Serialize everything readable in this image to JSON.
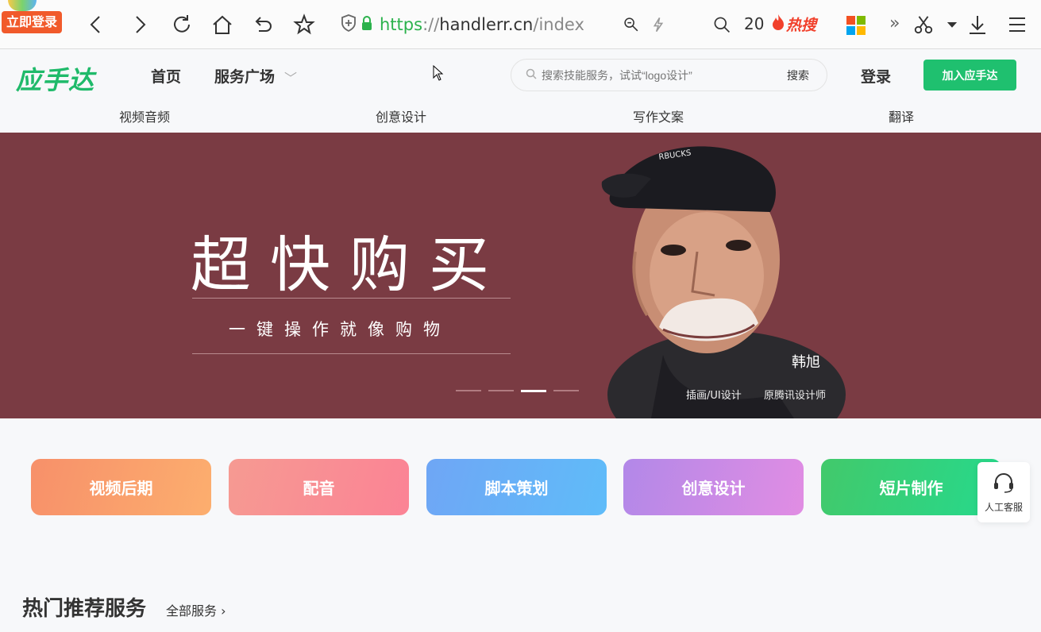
{
  "browser": {
    "login_badge": "立即登录",
    "url_proto": "https",
    "url_sep": "://",
    "url_host": "handlerr.cn",
    "url_path": "/index",
    "search_count": "20",
    "hot_label": "热搜"
  },
  "site": {
    "logo": "应手达",
    "nav": {
      "home": "首页",
      "service": "服务广场"
    },
    "search": {
      "placeholder": "搜索技能服务，试试“logo设计”",
      "button": "搜索"
    },
    "login": "登录",
    "join": "加入应手达",
    "subnav": [
      "视频音频",
      "创意设计",
      "写作文案",
      "翻译"
    ]
  },
  "banner": {
    "title": "超快购买",
    "subtitle": "一键操作就像购物",
    "person_name": "韩旭",
    "person_role": "插画/UI设计",
    "person_role2": "原腾讯设计师",
    "slides": 4,
    "active_slide": 3,
    "bg_color": "#7a3b43"
  },
  "categories": [
    {
      "label": "视频后期",
      "from": "#f7906a",
      "to": "#fcae6e"
    },
    {
      "label": "配音",
      "from": "#f69a92",
      "to": "#fb8395"
    },
    {
      "label": "脚本策划",
      "from": "#6fa6f5",
      "to": "#5fbcf9"
    },
    {
      "label": "创意设计",
      "from": "#b288e8",
      "to": "#e18de3"
    },
    {
      "label": "短片制作",
      "from": "#42c96b",
      "to": "#26d98c"
    }
  ],
  "customer_service": "人工客服",
  "section": {
    "title": "热门推荐服务",
    "all_link": "全部服务"
  }
}
